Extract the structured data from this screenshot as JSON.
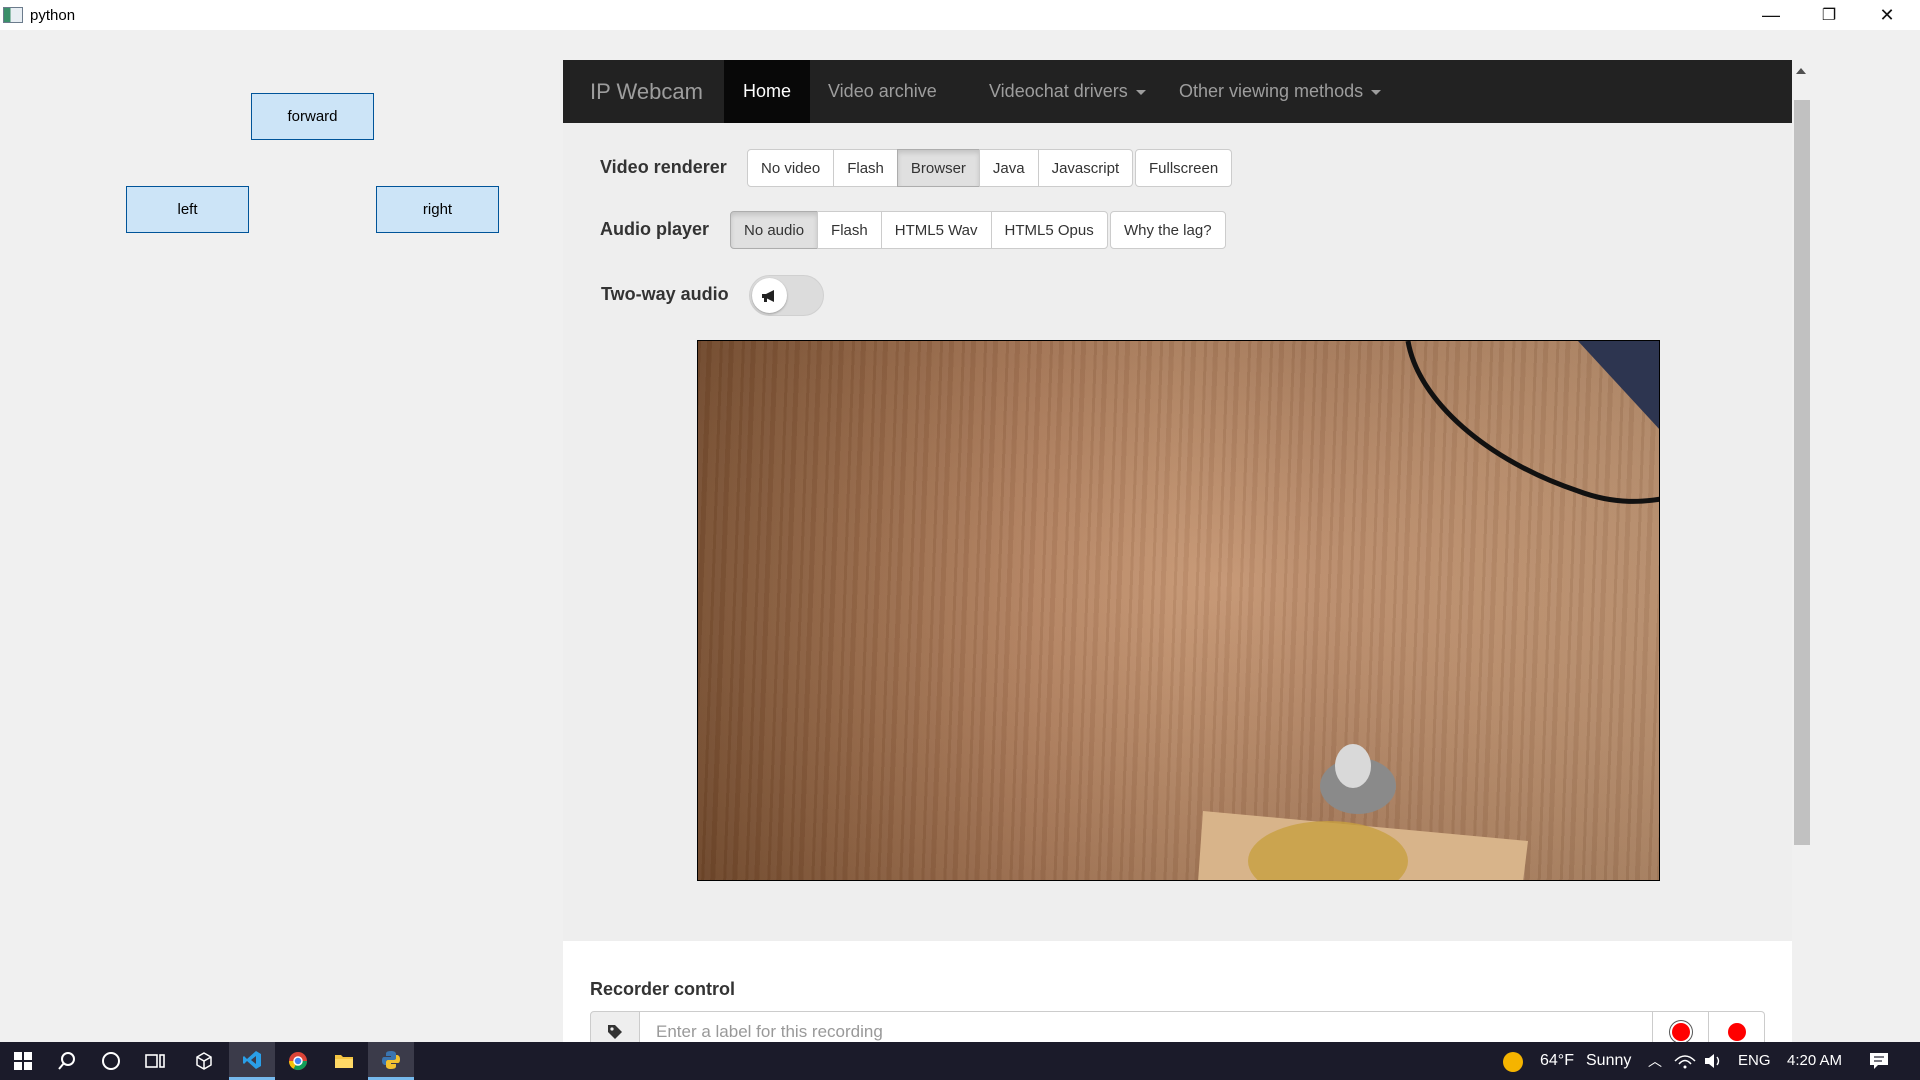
{
  "window": {
    "title": "python",
    "minimize_glyph": "—",
    "maximize_glyph": "❐",
    "close_glyph": "✕"
  },
  "controls": {
    "forward": "forward",
    "left": "left",
    "right": "right"
  },
  "navbar": {
    "brand": "IP Webcam",
    "items": [
      {
        "label": "Home",
        "active": true
      },
      {
        "label": "Video archive"
      },
      {
        "label": "Videochat drivers",
        "dropdown": true
      },
      {
        "label": "Other viewing methods",
        "dropdown": true
      }
    ]
  },
  "video_renderer": {
    "label": "Video renderer",
    "options": [
      "No video",
      "Flash",
      "Browser",
      "Java",
      "Javascript"
    ],
    "selected": "Browser",
    "fullscreen": "Fullscreen"
  },
  "audio_player": {
    "label": "Audio player",
    "options": [
      "No audio",
      "Flash",
      "HTML5 Wav",
      "HTML5 Opus"
    ],
    "selected": "No audio",
    "help": "Why the lag?"
  },
  "two_way_audio": {
    "label": "Two-way audio",
    "icon": "megaphone-icon",
    "enabled": false
  },
  "recorder": {
    "heading": "Recorder control",
    "placeholder": "Enter a label for this recording",
    "tag_icon": "tag-icon"
  },
  "taskbar": {
    "weather_temp": "64°F",
    "weather_text": "Sunny",
    "language": "ENG",
    "time": "4:20 AM"
  },
  "colors": {
    "navbar_bg": "#222222",
    "tk_button_bg": "#cce4f7",
    "record_red": "#ff0000",
    "taskbar_bg": "#1b1b2a"
  }
}
